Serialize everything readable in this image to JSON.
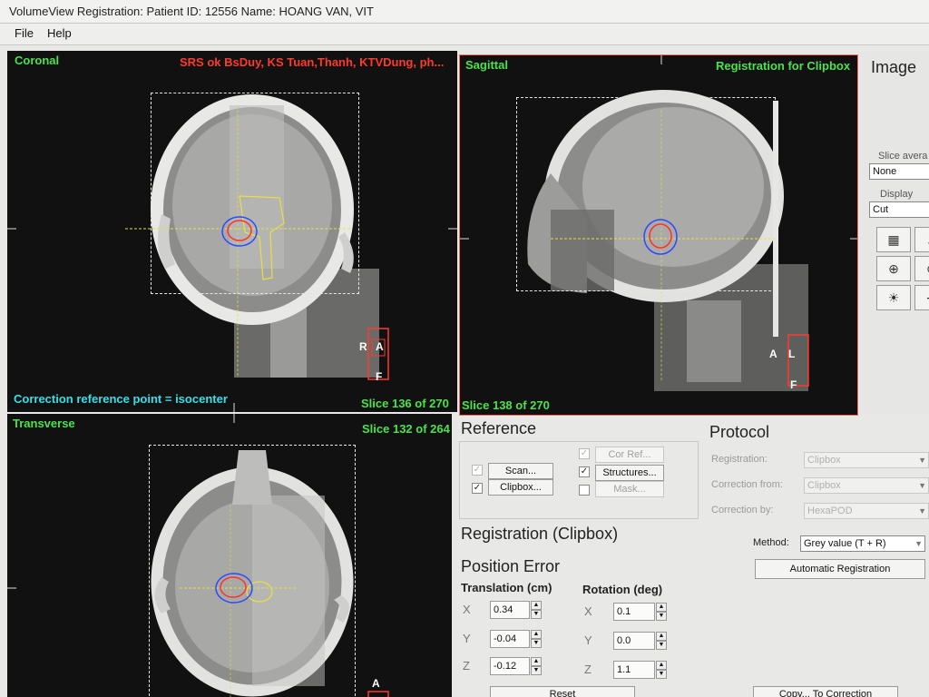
{
  "window": {
    "title": "VolumeView Registration: Patient ID: 12556   Name: HOANG VAN, VIT"
  },
  "menu": {
    "file": "File",
    "help": "Help"
  },
  "coronal": {
    "label": "Coronal",
    "plan_name": "SRS ok BsDuy, KS Tuan,Thanh, KTVDung, ph...",
    "correction_text": "Correction reference point = isocenter",
    "slice_text": "Slice 136 of 270",
    "orient": [
      "R",
      "A",
      "F"
    ]
  },
  "sagittal": {
    "label": "Sagittal",
    "registration_text": "Registration for Clipbox",
    "slice_text": "Slice 138 of 270",
    "orient": [
      "A",
      "L",
      "F"
    ]
  },
  "transverse": {
    "label": "Transverse",
    "slice_text": "Slice 132 of 264",
    "orient": [
      "A"
    ]
  },
  "image_panel": {
    "title": "Image",
    "slice_average_label": "Slice avera",
    "slice_average_value": "None",
    "display_mode_label": "Display me",
    "display_mode_value": "Cut"
  },
  "reference": {
    "title": "Reference",
    "scan": "Scan...",
    "clipbox": "Clipbox...",
    "cor_ref": "Cor Ref...",
    "structures": "Structures...",
    "mask": "Mask...",
    "scan_checked": "✓",
    "clipbox_checked": "✓",
    "cor_ref_checked": "✓",
    "structures_checked": "✓"
  },
  "protocol": {
    "title": "Protocol",
    "registration_label": "Registration:",
    "registration_value": "Clipbox",
    "correction_from_label": "Correction from:",
    "correction_from_value": "Clipbox",
    "correction_by_label": "Correction by:",
    "correction_by_value": "HexaPOD"
  },
  "registration": {
    "title": "Registration (Clipbox)",
    "method_label": "Method:",
    "method_value": "Grey value (T + R)",
    "auto_button": "Automatic Registration"
  },
  "position_error": {
    "title": "Position Error",
    "translation_header": "Translation (cm)",
    "rotation_header": "Rotation (deg)",
    "translation": {
      "x_label": "X",
      "x": "0.34",
      "y_label": "Y",
      "y": "-0.04",
      "z_label": "Z",
      "z": "-0.12"
    },
    "rotation": {
      "x_label": "X",
      "x": "0.1",
      "y_label": "Y",
      "y": "0.0",
      "z_label": "Z",
      "z": "1.1"
    },
    "reset_button": "Reset",
    "copy_button": "Copy... To Correction"
  },
  "colors": {
    "viewport_bg": "#111111",
    "label_green": "#4be24b",
    "label_red": "#ff3a2a",
    "label_cyan": "#36e0e8",
    "contour_blue": "#2a4bff",
    "contour_red": "#ff3030",
    "marker_red": "#ff3a2a",
    "crosshair": "#e8e040"
  }
}
